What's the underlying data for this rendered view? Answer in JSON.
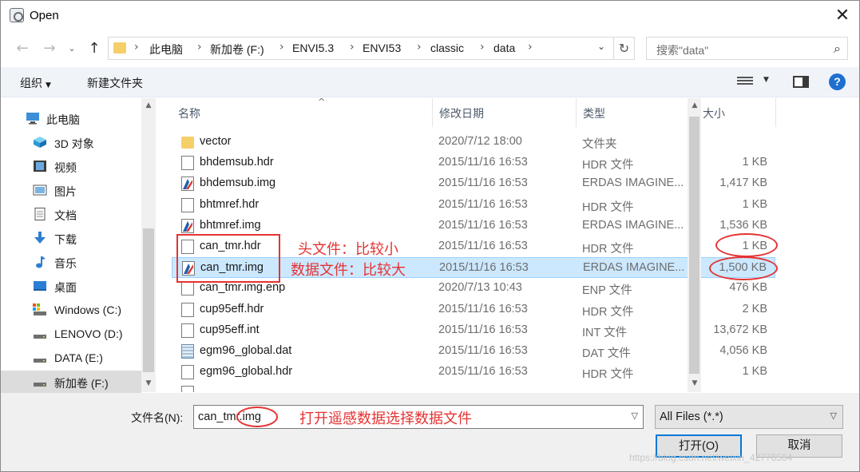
{
  "window": {
    "title": "Open",
    "close": "✕"
  },
  "nav": {
    "back": "←",
    "forward": "→",
    "down": "⌄",
    "up": "↑",
    "refresh": "↻",
    "dropdown": "⌄"
  },
  "breadcrumbs": [
    "此电脑",
    "新加卷 (F:)",
    "ENVI5.3",
    "ENVI53",
    "classic",
    "data"
  ],
  "search": {
    "placeholder": "搜索\"data\"",
    "icon": "search-icon"
  },
  "toolbar": {
    "organize": "组织",
    "new_folder": "新建文件夹",
    "help": "?"
  },
  "sidebar": {
    "items": [
      {
        "label": "此电脑",
        "icon": "computer-icon"
      },
      {
        "label": "3D 对象",
        "icon": "cube-icon"
      },
      {
        "label": "视频",
        "icon": "video-icon"
      },
      {
        "label": "图片",
        "icon": "picture-icon"
      },
      {
        "label": "文档",
        "icon": "document-icon"
      },
      {
        "label": "下载",
        "icon": "download-icon"
      },
      {
        "label": "音乐",
        "icon": "music-icon"
      },
      {
        "label": "桌面",
        "icon": "desktop-icon"
      },
      {
        "label": "Windows (C:)",
        "icon": "drive-icon"
      },
      {
        "label": "LENOVO (D:)",
        "icon": "drive-icon"
      },
      {
        "label": "DATA (E:)",
        "icon": "drive-icon"
      },
      {
        "label": "新加卷 (F:)",
        "icon": "drive-icon"
      }
    ]
  },
  "columns": {
    "name": "名称",
    "date": "修改日期",
    "type": "类型",
    "size": "大小"
  },
  "files": [
    {
      "name": "vector",
      "date": "2020/7/12 18:00",
      "type": "文件夹",
      "size": "",
      "icon": "folder"
    },
    {
      "name": "bhdemsub.hdr",
      "date": "2015/11/16 16:53",
      "type": "HDR 文件",
      "size": "1 KB",
      "icon": "doc"
    },
    {
      "name": "bhdemsub.img",
      "date": "2015/11/16 16:53",
      "type": "ERDAS IMAGINE...",
      "size": "1,417 KB",
      "icon": "img"
    },
    {
      "name": "bhtmref.hdr",
      "date": "2015/11/16 16:53",
      "type": "HDR 文件",
      "size": "1 KB",
      "icon": "doc"
    },
    {
      "name": "bhtmref.img",
      "date": "2015/11/16 16:53",
      "type": "ERDAS IMAGINE...",
      "size": "1,536 KB",
      "icon": "img"
    },
    {
      "name": "can_tmr.hdr",
      "date": "2015/11/16 16:53",
      "type": "HDR 文件",
      "size": "1 KB",
      "icon": "doc"
    },
    {
      "name": "can_tmr.img",
      "date": "2015/11/16 16:53",
      "type": "ERDAS IMAGINE...",
      "size": "1,500 KB",
      "icon": "img"
    },
    {
      "name": "can_tmr.img.enp",
      "date": "2020/7/13 10:43",
      "type": "ENP 文件",
      "size": "476 KB",
      "icon": "doc"
    },
    {
      "name": "cup95eff.hdr",
      "date": "2015/11/16 16:53",
      "type": "HDR 文件",
      "size": "2 KB",
      "icon": "doc"
    },
    {
      "name": "cup95eff.int",
      "date": "2015/11/16 16:53",
      "type": "INT 文件",
      "size": "13,672 KB",
      "icon": "doc"
    },
    {
      "name": "egm96_global.dat",
      "date": "2015/11/16 16:53",
      "type": "DAT 文件",
      "size": "4,056 KB",
      "icon": "dat"
    },
    {
      "name": "egm96_global.hdr",
      "date": "2015/11/16 16:53",
      "type": "HDR 文件",
      "size": "1 KB",
      "icon": "doc"
    },
    {
      "name": "",
      "date": "",
      "type": "",
      "size": "",
      "icon": "doc"
    }
  ],
  "selected_file": "can_tmr.img",
  "bottom": {
    "filename_label": "文件名(N):",
    "filename_value": "can_tmr.img",
    "filter_value": "All Files (*.*)",
    "open_label": "打开(O)",
    "cancel_label": "取消"
  },
  "annotations": {
    "header_note": "头文件：比较小",
    "data_note": "数据文件：比较大",
    "open_note": "打开遥感数据选择数据文件"
  },
  "watermark": "https://blog.csdn.net/weixin_42776564",
  "colors": {
    "accent": "#0078d7",
    "annotation": "#e53333",
    "selection": "#cce8ff"
  }
}
